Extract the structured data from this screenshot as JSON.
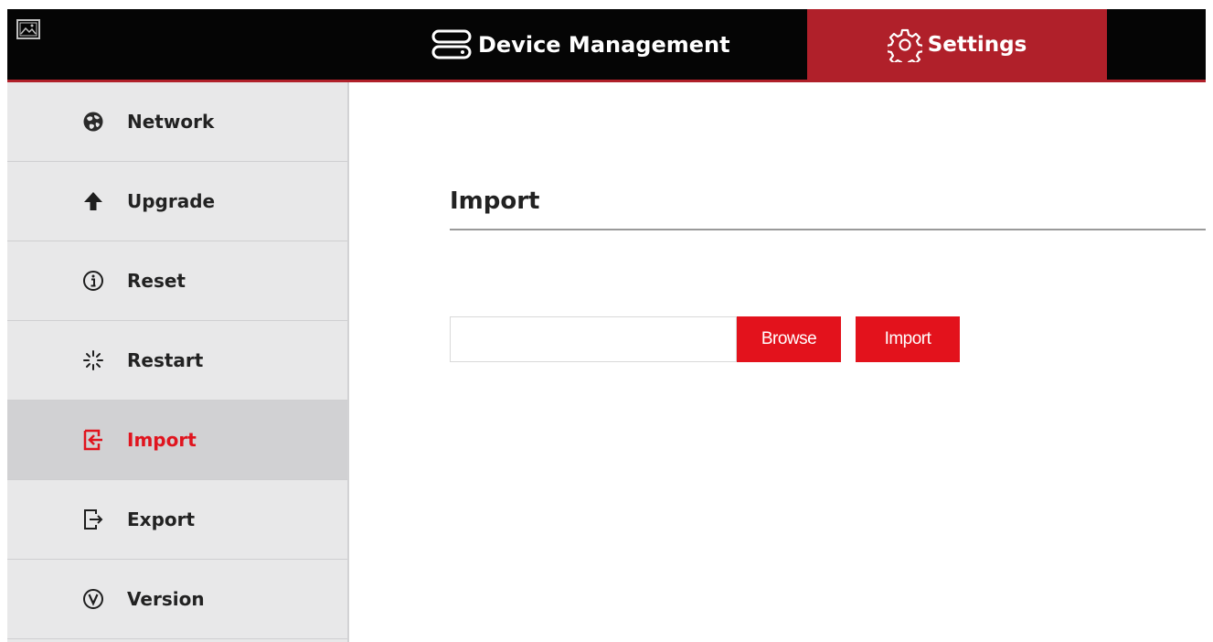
{
  "header": {
    "tabs": [
      {
        "label": "Device Management",
        "icon": "server-stack-icon",
        "active": false
      },
      {
        "label": "Settings",
        "icon": "gear-icon",
        "active": true
      }
    ]
  },
  "sidebar": {
    "items": [
      {
        "label": "Network",
        "icon": "globe-icon",
        "active": false
      },
      {
        "label": "Upgrade",
        "icon": "arrow-up-icon",
        "active": false
      },
      {
        "label": "Reset",
        "icon": "info-icon",
        "active": false
      },
      {
        "label": "Restart",
        "icon": "spinner-icon",
        "active": false
      },
      {
        "label": "Import",
        "icon": "import-icon",
        "active": true
      },
      {
        "label": "Export",
        "icon": "export-icon",
        "active": false
      },
      {
        "label": "Version",
        "icon": "version-icon",
        "active": false
      }
    ]
  },
  "main": {
    "title": "Import",
    "file_input": {
      "value": "",
      "placeholder": ""
    },
    "browse_label": "Browse",
    "import_label": "Import"
  },
  "colors": {
    "accent": "#e3121c",
    "tab_active": "#b0202a",
    "topbar": "#050505",
    "sidebar_bg": "#e8e8e9",
    "sidebar_active_bg": "#d1d1d3"
  }
}
